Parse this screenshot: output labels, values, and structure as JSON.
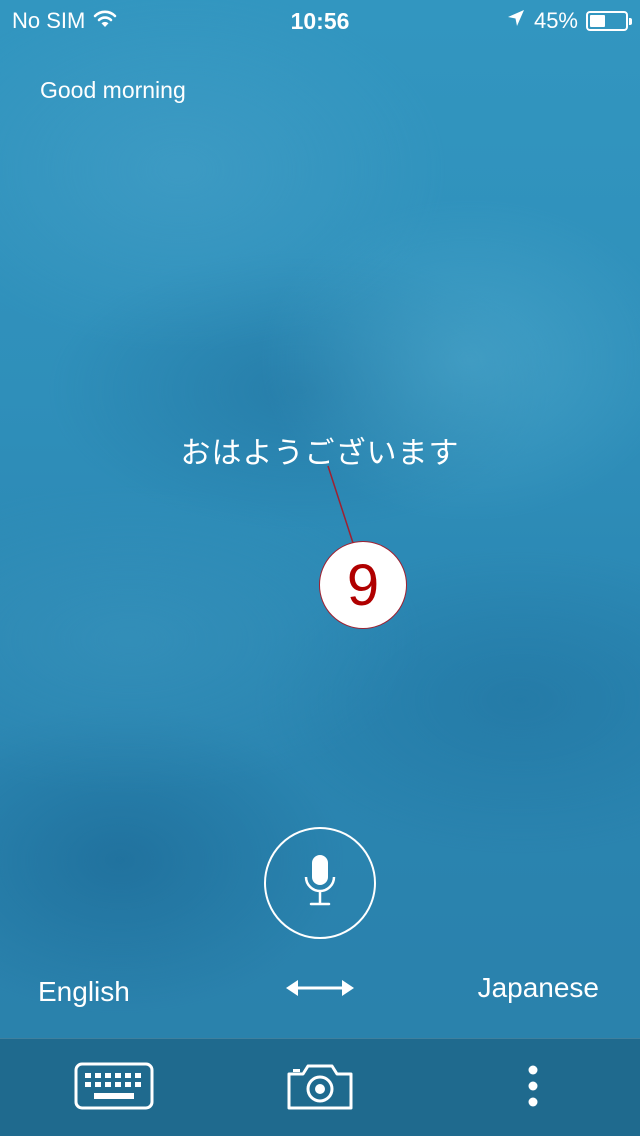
{
  "status_bar": {
    "carrier": "No SIM",
    "time": "10:56",
    "battery_percent": "45%",
    "battery_level": 0.45,
    "icons": [
      "wifi-icon",
      "location-arrow-icon",
      "battery-icon"
    ]
  },
  "translation": {
    "source_text": "Good morning",
    "translated_text": "おはようございます"
  },
  "annotation": {
    "number": "9"
  },
  "language_bar": {
    "source_language": "English",
    "target_language": "Japanese",
    "swap_icon": "swap-arrows-icon",
    "mic_icon": "microphone-icon"
  },
  "toolbar": {
    "icons": [
      "keyboard-icon",
      "camera-icon",
      "more-vertical-icon"
    ]
  },
  "colors": {
    "background": "#2f8fba",
    "toolbar": "#1f6a8e",
    "text": "#ffffff",
    "annotation_text": "#b00000",
    "annotation_border": "#a02030"
  }
}
